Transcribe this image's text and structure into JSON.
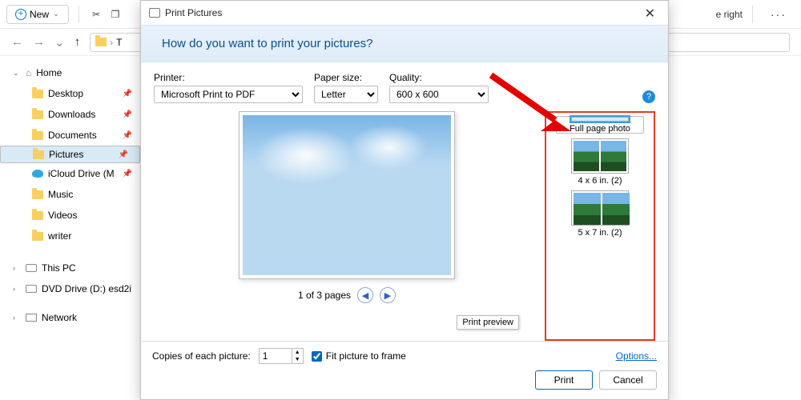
{
  "toolbar": {
    "new_label": "New",
    "right_txt": "e right"
  },
  "nav": {
    "addr_hint": "T"
  },
  "navpane": {
    "home": "Home",
    "desktop": "Desktop",
    "downloads": "Downloads",
    "documents": "Documents",
    "pictures": "Pictures",
    "icloud": "iCloud Drive (M",
    "music": "Music",
    "videos": "Videos",
    "writer": "writer",
    "thispc": "This PC",
    "dvd": "DVD Drive (D:) esd2i",
    "network": "Network"
  },
  "dialog": {
    "title": "Print Pictures",
    "hero": "How do you want to print your pictures?",
    "printer_lbl": "Printer:",
    "printer_val": "Microsoft Print to PDF",
    "paper_lbl": "Paper size:",
    "paper_val": "Letter",
    "quality_lbl": "Quality:",
    "quality_val": "600 x 600",
    "pager": "1 of 3 pages",
    "preview_tip": "Print preview",
    "layout_full": "Full page photo",
    "layout_4x6": "4 x 6 in. (2)",
    "layout_5x7": "5 x 7 in. (2)",
    "copies_lbl": "Copies of each picture:",
    "copies_val": "1",
    "fit_lbl": "Fit picture to frame",
    "options": "Options...",
    "print": "Print",
    "cancel": "Cancel"
  }
}
